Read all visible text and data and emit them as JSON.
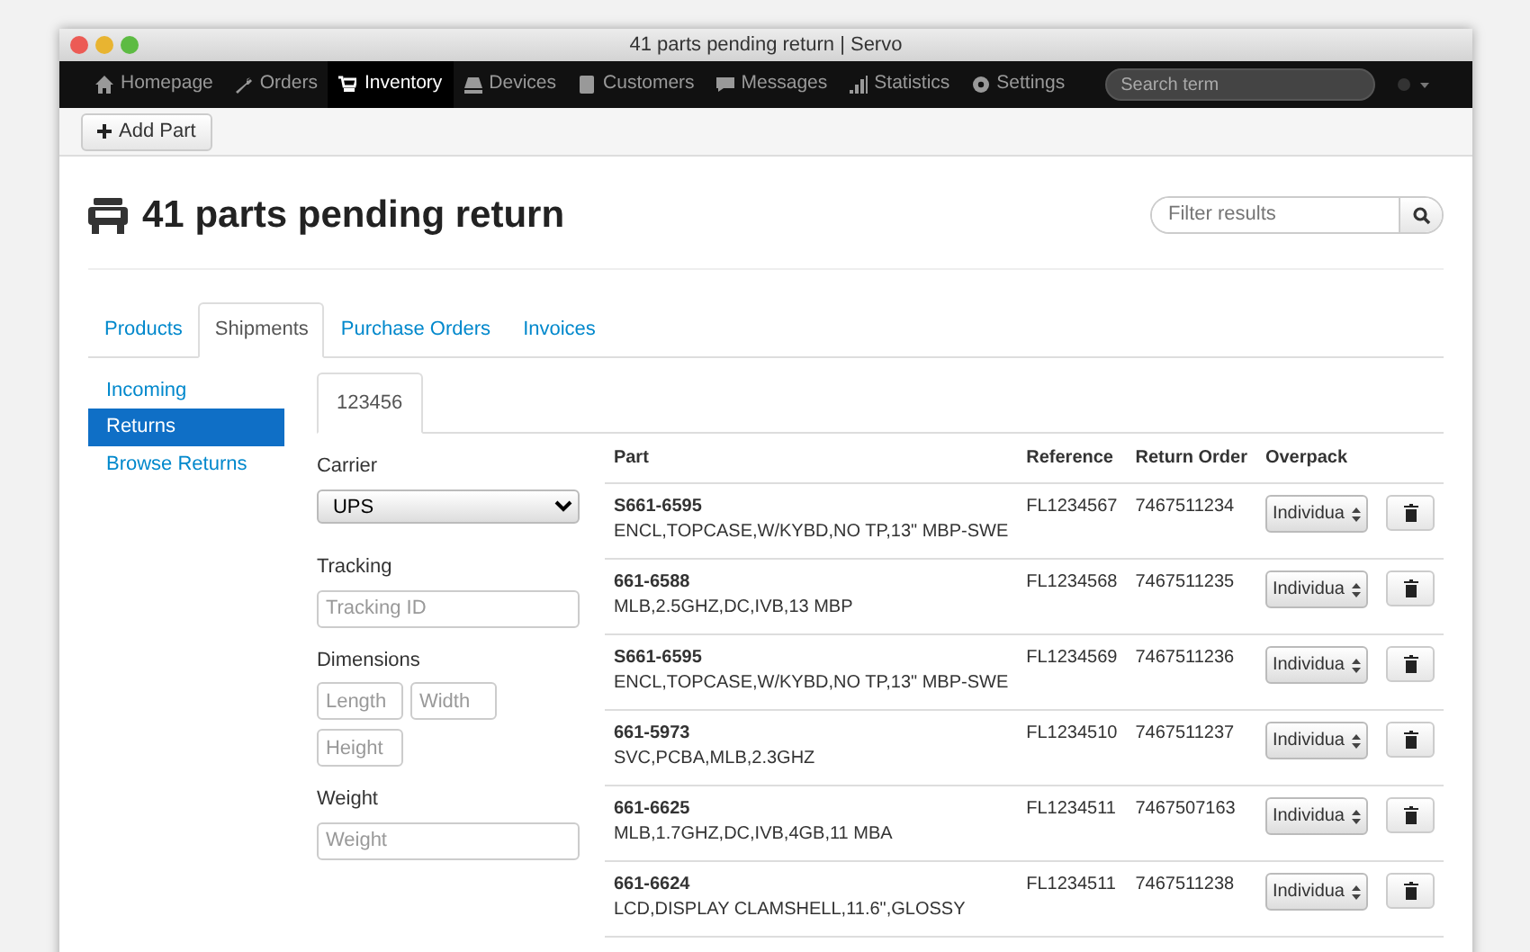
{
  "window": {
    "title": "41 parts pending return | Servo"
  },
  "navbar": {
    "items": [
      {
        "label": "Homepage",
        "selected": false
      },
      {
        "label": "Orders",
        "selected": false
      },
      {
        "label": "Inventory",
        "selected": true
      },
      {
        "label": "Devices",
        "selected": false
      },
      {
        "label": "Customers",
        "selected": false
      },
      {
        "label": "Messages",
        "selected": false
      },
      {
        "label": "Statistics",
        "selected": false
      },
      {
        "label": "Settings",
        "selected": false
      }
    ],
    "search": {
      "placeholder": "Search term"
    }
  },
  "toolbar": {
    "add_button": "Add Part"
  },
  "page": {
    "title": "41 parts pending return",
    "filter": {
      "placeholder": "Filter results"
    }
  },
  "tabs": [
    {
      "label": "Products",
      "selected": false
    },
    {
      "label": "Shipments",
      "selected": true
    },
    {
      "label": "Purchase Orders",
      "selected": false
    },
    {
      "label": "Invoices",
      "selected": false
    }
  ],
  "sidebar": {
    "items": [
      {
        "label": "Incoming",
        "selected": false
      },
      {
        "label": "Returns",
        "selected": true
      },
      {
        "label": "Browse Returns",
        "selected": false
      }
    ]
  },
  "shipment_tabs": [
    {
      "label": "123456",
      "selected": true
    }
  ],
  "form": {
    "carrier": {
      "label": "Carrier",
      "value": "UPS"
    },
    "tracking": {
      "label": "Tracking",
      "placeholder": "Tracking ID"
    },
    "dimensions": {
      "label": "Dimensions",
      "fields": [
        {
          "placeholder": "Length"
        },
        {
          "placeholder": "Width"
        },
        {
          "placeholder": "Height"
        }
      ]
    },
    "weight": {
      "label": "Weight",
      "placeholder": "Weight"
    }
  },
  "table": {
    "columns": [
      "Part",
      "Reference",
      "Return Order",
      "Overpack"
    ],
    "rows": [
      {
        "part": "S661-6595",
        "description": "ENCL,TOPCASE,W/KYBD,NO TP,13\" MBP-SWE",
        "reference": "FL1234567",
        "return_order": "7467511234",
        "overpack": "Individua"
      },
      {
        "part": "661-6588",
        "description": "MLB,2.5GHZ,DC,IVB,13 MBP",
        "reference": "FL1234568",
        "return_order": "7467511235",
        "overpack": "Individua"
      },
      {
        "part": "S661-6595",
        "description": "ENCL,TOPCASE,W/KYBD,NO TP,13\" MBP-SWE",
        "reference": "FL1234569",
        "return_order": "7467511236",
        "overpack": "Individua"
      },
      {
        "part": "661-5973",
        "description": "SVC,PCBA,MLB,2.3GHZ",
        "reference": "FL1234510",
        "return_order": "7467511237",
        "overpack": "Individua"
      },
      {
        "part": "661-6625",
        "description": "MLB,1.7GHZ,DC,IVB,4GB,11 MBA",
        "reference": "FL1234511",
        "return_order": "7467507163",
        "overpack": "Individua"
      },
      {
        "part": "661-6624",
        "description": "LCD,DISPLAY CLAMSHELL,11.6\",GLOSSY",
        "reference": "FL1234511",
        "return_order": "7467511238",
        "overpack": "Individua"
      }
    ]
  }
}
